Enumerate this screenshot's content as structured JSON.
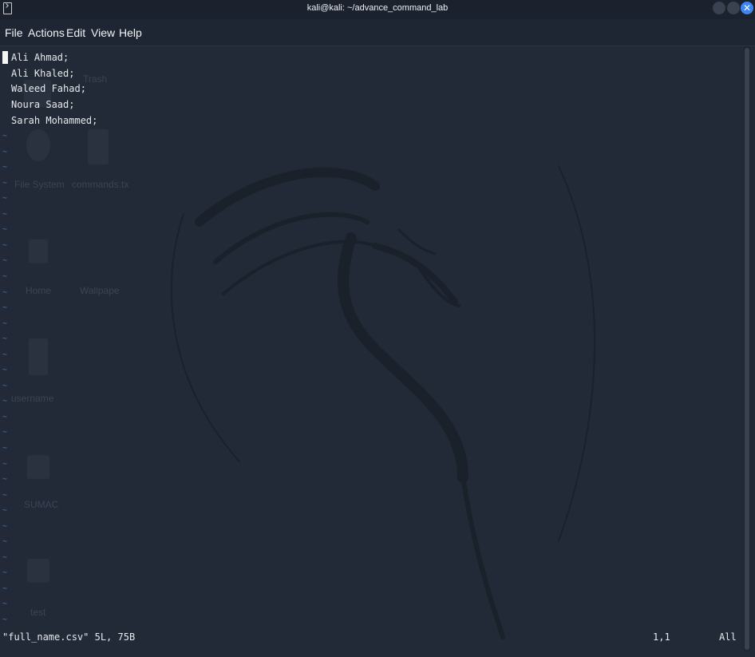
{
  "titlebar": {
    "title": "kali@kali: ~/advance_command_lab",
    "close_glyph": "✕"
  },
  "menubar": {
    "items": [
      "File",
      "Actions",
      "Edit",
      "View",
      "Help"
    ]
  },
  "desktop_ghost_labels": [
    "Trash",
    "File System",
    "commands.tx",
    "Home",
    "Wallpape",
    "username",
    "SUMAC",
    "test"
  ],
  "editor": {
    "lines": [
      "Ali Ahmad;",
      "Ali Khaled;",
      "Waleed Fahad;",
      "Noura Saad;",
      "Sarah Mohammed;"
    ],
    "empty_line_marker": "~"
  },
  "statusline": {
    "file_info": "\"full_name.csv\" 5L, 75B",
    "position": "1,1",
    "scroll": "All"
  },
  "colors": {
    "background": "#222a37",
    "text": "#e7e9ec",
    "tilde": "#3b76b8",
    "close_button": "#3d86f1"
  },
  "icons": [
    "terminal-icon",
    "minimize-icon",
    "maximize-icon",
    "close-icon"
  ]
}
